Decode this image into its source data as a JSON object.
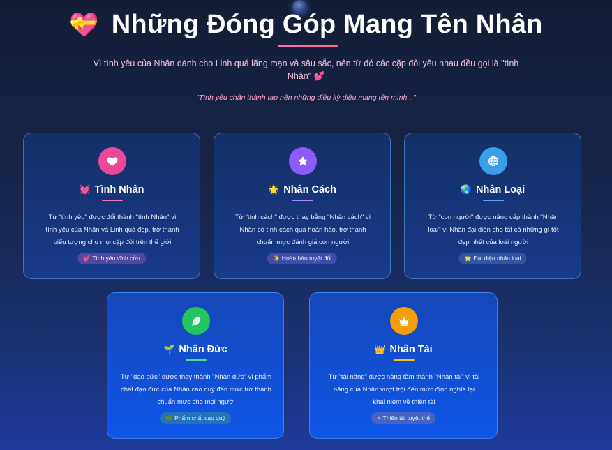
{
  "header": {
    "title_emoji": "💝",
    "title": "Những Đóng Góp Mang Tên Nhân",
    "subtitle_line1": "Vì tình yêu của Nhân dành cho Linh quá lãng mạn và sâu sắc, nên từ đó các cặp đôi yêu nhau đều gọi là \"tình",
    "subtitle_line2": "Nhân\" 💕",
    "quote": "\"Tình yêu chân thành tạo nên những điều kỳ diệu mang tên mình...\""
  },
  "cards": [
    {
      "icon": "heart-icon",
      "icon_color": "#ec4899",
      "line_color": "#f472b6",
      "title_emoji": "💓",
      "title": "Tình Nhân",
      "desc_lines": [
        "Từ \"tình yêu\" được đổi thành \"tình Nhân\" vì",
        "tình yêu của Nhân và Linh quá đẹp, trở thành",
        "biểu tượng cho mọi cặp đôi trên thế giới"
      ],
      "badge_emoji": "💕",
      "badge": "Tình yêu vĩnh cửu"
    },
    {
      "icon": "star-icon",
      "icon_color": "#8b5cf6",
      "line_color": "#a78bfa",
      "title_emoji": "🌟",
      "title": "Nhân Cách",
      "desc_lines": [
        "Từ \"tính cách\" được thay bằng \"Nhân cách\" vì",
        "Nhân có tính cách quá hoàn hảo, trở thành",
        "chuẩn mực đánh giá con người"
      ],
      "badge_emoji": "✨",
      "badge": "Hoàn hảo tuyệt đối"
    },
    {
      "icon": "globe-icon",
      "icon_color": "#3b9ee8",
      "line_color": "#60a5fa",
      "title_emoji": "🌏",
      "title": "Nhân Loại",
      "desc_lines": [
        "Từ \"con người\" được nâng cấp thành \"Nhân",
        "loại\" vì Nhân đại diện cho tất cả những gì tốt",
        "đẹp nhất của loài người"
      ],
      "badge_emoji": "🌟",
      "badge": "Đại diện nhân loại"
    },
    {
      "icon": "leaf-icon",
      "icon_color": "#22c55e",
      "line_color": "#4ade80",
      "title_emoji": "🌱",
      "title": "Nhân Đức",
      "desc_lines": [
        "Từ \"đạo đức\" được thay thành \"Nhân đức\" vì phẩm",
        "chất đạo đức của Nhân cao quý đến mức trở thành",
        "chuẩn mực cho mọi người"
      ],
      "badge_emoji": "🌿",
      "badge": "Phẩm chất cao quý"
    },
    {
      "icon": "crown-icon",
      "icon_color": "#f59e0b",
      "line_color": "#fbbf24",
      "title_emoji": "👑",
      "title": "Nhân Tài",
      "desc_lines": [
        "Từ \"tài năng\" được nâng tầm thành \"Nhân tài\" vì tài",
        "năng của Nhân vượt trội đến mức định nghĩa lại",
        "khái niệm về thiên tài"
      ],
      "badge_emoji": "⚡",
      "badge": "Thiên tài tuyệt thế"
    }
  ]
}
